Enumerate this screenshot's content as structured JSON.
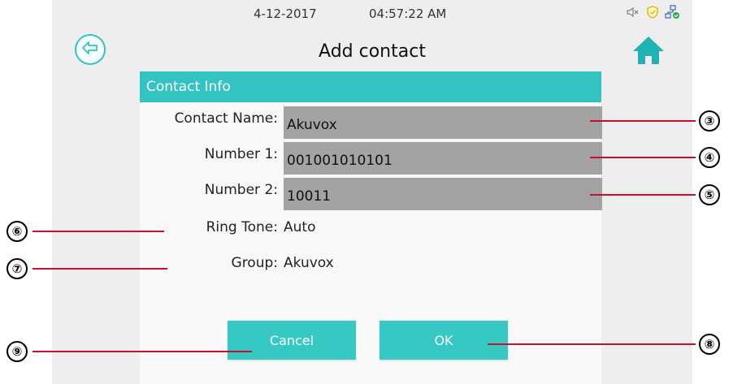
{
  "status_bar": {
    "date": "4-12-2017",
    "time": "04:57:22 AM",
    "icons": [
      "speaker-muted-icon",
      "shield-icon",
      "network-icon"
    ]
  },
  "header": {
    "title": "Add contact",
    "back_icon": "back-arrow-icon",
    "home_icon": "home-icon"
  },
  "section": {
    "title": "Contact Info"
  },
  "fields": {
    "contact_name": {
      "label": "Contact Name:",
      "value": "Akuvox"
    },
    "number1": {
      "label": "Number 1:",
      "value": "001001010101"
    },
    "number2": {
      "label": "Number 2:",
      "value": "10011"
    },
    "ring_tone": {
      "label": "Ring Tone:",
      "value": "Auto"
    },
    "group": {
      "label": "Group:",
      "value": "Akuvox"
    }
  },
  "buttons": {
    "cancel": "Cancel",
    "ok": "OK"
  },
  "callouts": {
    "contact_name": "③",
    "number1": "④",
    "number2": "⑤",
    "ring_tone": "⑥",
    "group": "⑦",
    "ok": "⑧",
    "cancel": "⑨"
  },
  "colors": {
    "accent": "#33c3c3",
    "field_bg": "#a3a3a3",
    "callout_line": "#c8102e",
    "home_icon": "#1fb3b3"
  }
}
